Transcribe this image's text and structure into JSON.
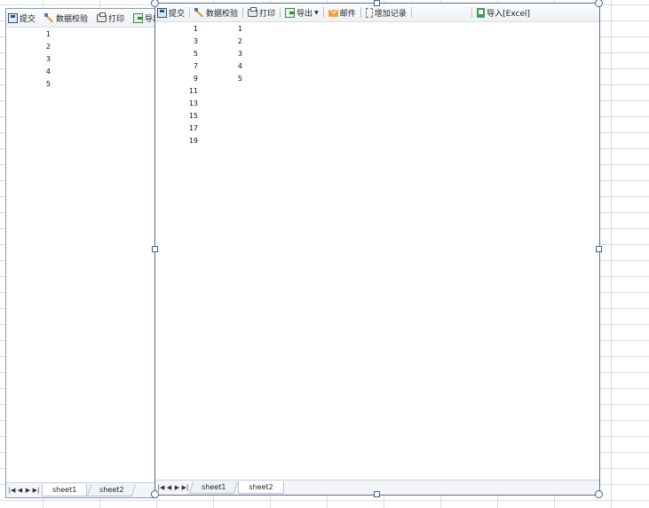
{
  "left_panel": {
    "toolbar": {
      "submit_label": "提交",
      "validate_label": "数据校验",
      "print_label": "打印",
      "export_label": "导出"
    },
    "cells": [
      "1",
      "2",
      "3",
      "4",
      "5"
    ],
    "tabs": [
      "sheet1",
      "sheet2"
    ]
  },
  "right_panel": {
    "toolbar": {
      "submit_label": "提交",
      "validate_label": "数据校验",
      "print_label": "打印",
      "export_label": "导出",
      "mail_label": "邮件",
      "add_record_label": "增加记录",
      "import_label": "导入[Excel]"
    },
    "column_a": [
      "1",
      "3",
      "5",
      "7",
      "9",
      "11",
      "13",
      "15",
      "17",
      "19"
    ],
    "column_b": [
      "1",
      "2",
      "3",
      "4",
      "5"
    ],
    "tabs": [
      "sheet1",
      "sheet2"
    ]
  },
  "icons": {
    "submit": "save-icon",
    "validate": "validate-icon",
    "print": "printer-icon",
    "export": "export-icon",
    "mail": "mail-icon",
    "add_record": "add-record-icon",
    "import": "excel-import-icon"
  },
  "colors": {
    "grid": "#d6dde8",
    "panel_border": "#5b6e8c",
    "toolbar_bg": "#eef1f5"
  }
}
